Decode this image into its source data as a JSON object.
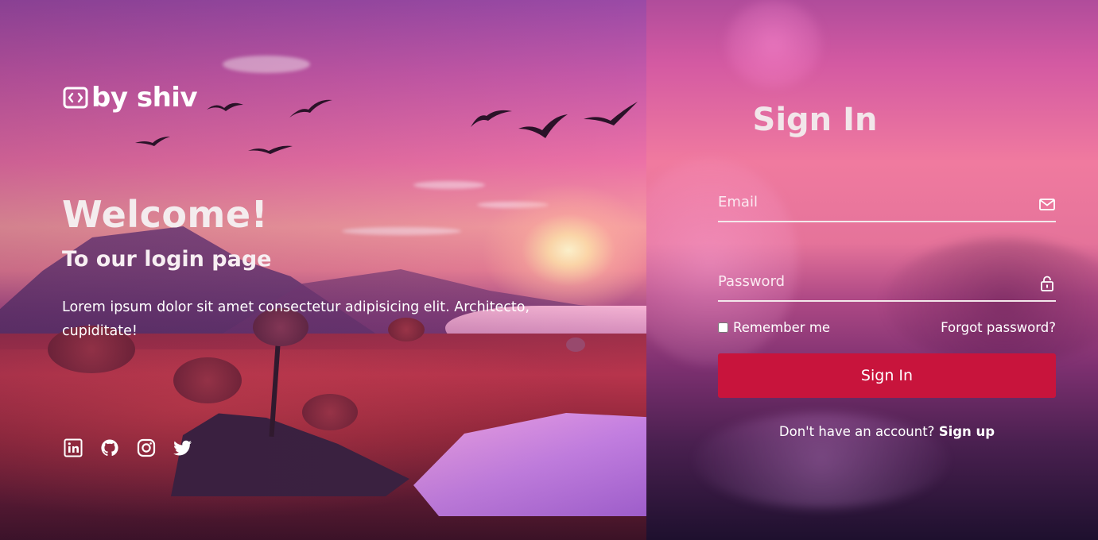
{
  "brand": {
    "name": "by shiv",
    "icon": "code-icon"
  },
  "hero": {
    "title": "Welcome!",
    "subtitle": "To our login page",
    "description": "Lorem ipsum dolor sit amet consectetur adipisicing elit. Architecto, cupiditate!"
  },
  "social": [
    {
      "icon": "linkedin-icon"
    },
    {
      "icon": "github-icon"
    },
    {
      "icon": "instagram-icon"
    },
    {
      "icon": "twitter-icon"
    }
  ],
  "form": {
    "title": "Sign In",
    "email": {
      "placeholder": "Email",
      "value": "",
      "icon": "mail-icon"
    },
    "password": {
      "placeholder": "Password",
      "value": "",
      "icon": "lock-icon"
    },
    "remember_label": "Remember me",
    "remember_checked": false,
    "forgot_label": "Forgot password?",
    "submit_label": "Sign In",
    "signup_prompt": "Don't have an account?",
    "signup_link": "Sign up"
  },
  "colors": {
    "button": "#c8143c",
    "text": "#ffffff"
  }
}
